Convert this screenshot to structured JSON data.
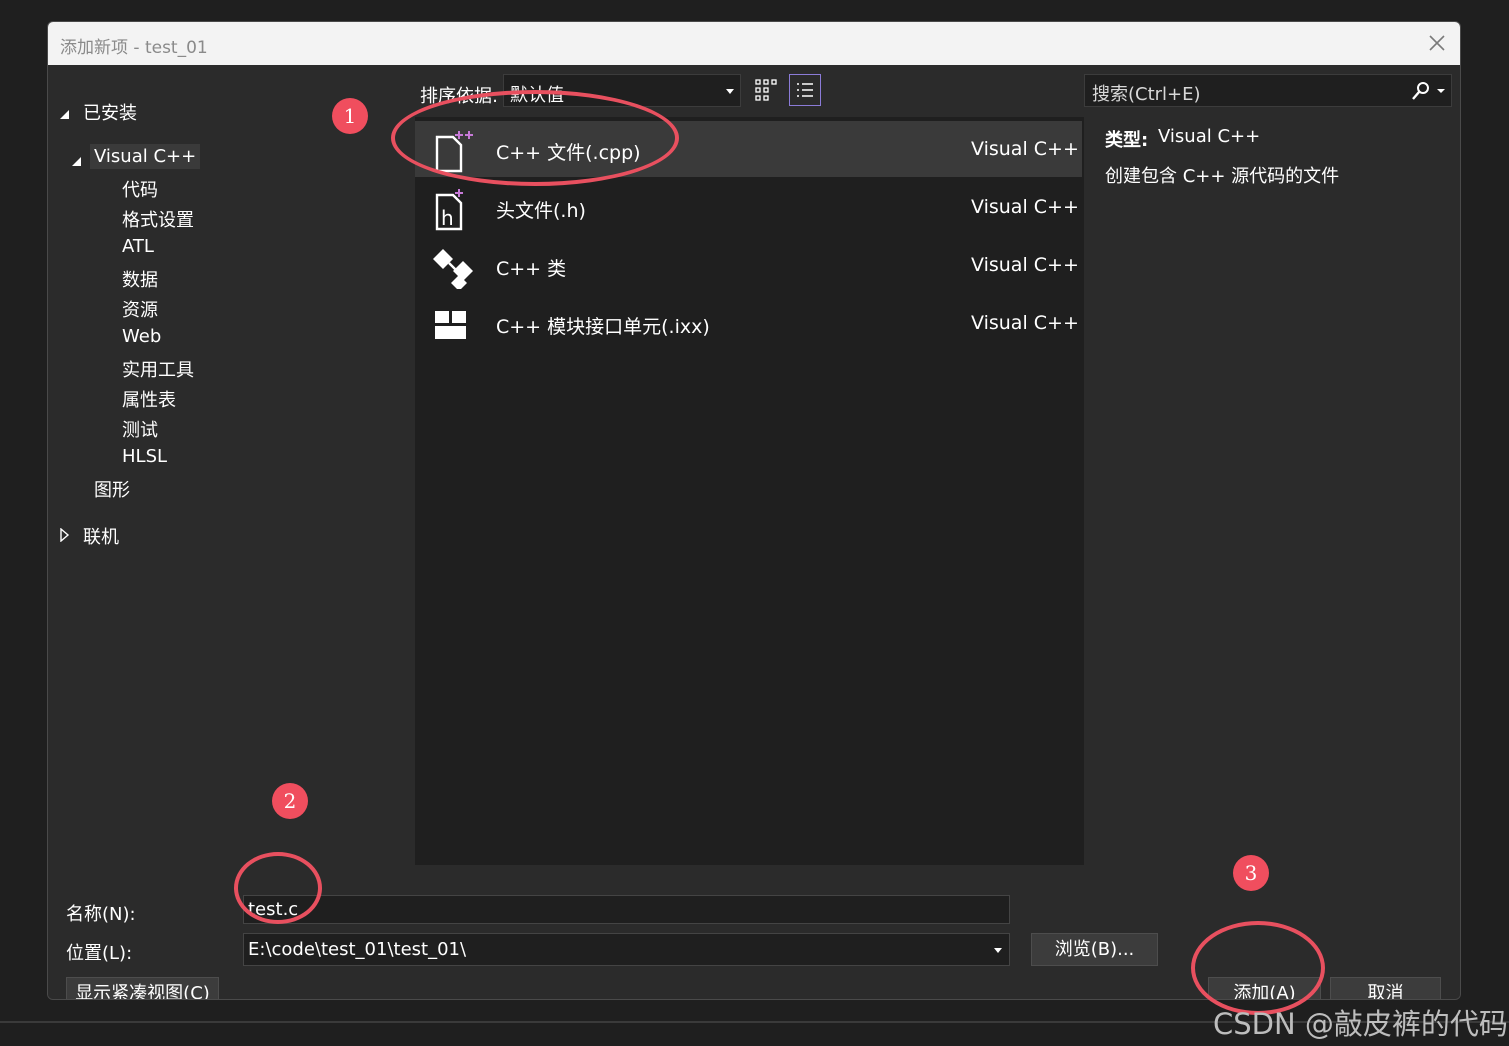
{
  "window": {
    "title": "添加新项 - test_01"
  },
  "sidebar": {
    "installed": "已安装",
    "visual_cpp": "Visual C++",
    "children": [
      "代码",
      "格式设置",
      "ATL",
      "数据",
      "资源",
      "Web",
      "实用工具",
      "属性表",
      "测试",
      "HLSL"
    ],
    "graphics": "图形",
    "online": "联机"
  },
  "toolbar": {
    "sort_label": "排序依据:",
    "sort_value": "默认值",
    "search_placeholder": "搜索(Ctrl+E)"
  },
  "templates": [
    {
      "name": "C++ 文件(.cpp)",
      "lang": "Visual C++",
      "icon": "cpp-file-icon",
      "selected": true
    },
    {
      "name": "头文件(.h)",
      "lang": "Visual C++",
      "icon": "header-file-icon",
      "selected": false
    },
    {
      "name": "C++ 类",
      "lang": "Visual C++",
      "icon": "class-icon",
      "selected": false
    },
    {
      "name": "C++ 模块接口单元(.ixx)",
      "lang": "Visual C++",
      "icon": "module-icon",
      "selected": false
    }
  ],
  "details": {
    "type_label": "类型:",
    "type_value": "Visual C++",
    "description": "创建包含 C++ 源代码的文件"
  },
  "form": {
    "name_label": "名称(N):",
    "name_value": "test.c",
    "location_label": "位置(L):",
    "location_value": "E:\\code\\test_01\\test_01\\",
    "browse_label": "浏览(B)...",
    "compact_view_label": "显示紧凑视图(C)",
    "add_label": "添加(A)",
    "cancel_label": "取消"
  },
  "annotations": {
    "step1": "1",
    "step2": "2",
    "step3": "3"
  },
  "watermark": "CSDN @敲皮裤的代码",
  "colors": {
    "accent_annotation": "#e8505f",
    "selection": "#3a3a3a",
    "view_toggle_border": "#8b7bd8",
    "icon_plus": "#c77ad8"
  }
}
